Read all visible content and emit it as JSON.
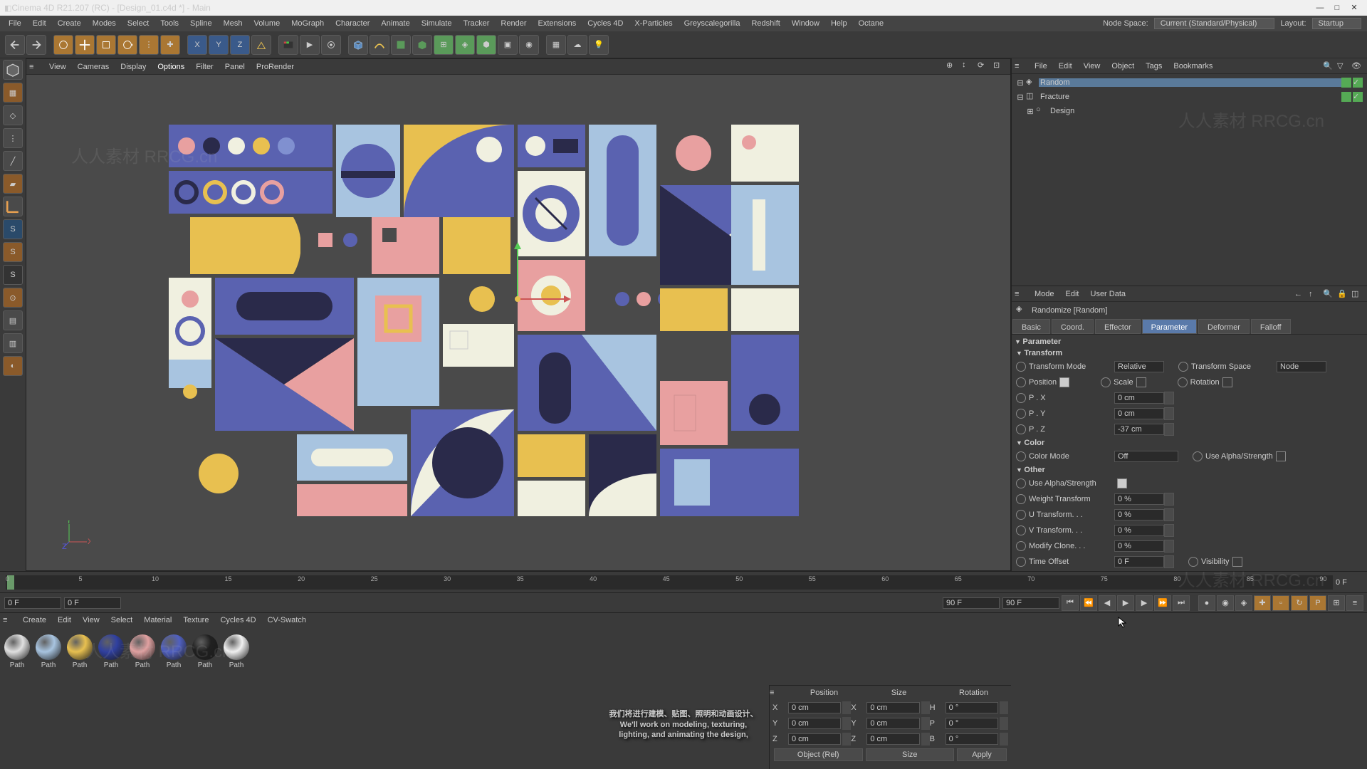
{
  "titlebar": {
    "title": "Cinema 4D R21.207 (RC) - [Design_01.c4d *] - Main"
  },
  "menubar": {
    "items": [
      "File",
      "Edit",
      "Create",
      "Modes",
      "Select",
      "Tools",
      "Spline",
      "Mesh",
      "Volume",
      "MoGraph",
      "Character",
      "Animate",
      "Simulate",
      "Tracker",
      "Render",
      "Extensions",
      "Cycles 4D",
      "X-Particles",
      "Greyscalegorilla",
      "Redshift",
      "Window",
      "Help",
      "Octane"
    ],
    "nodespace_label": "Node Space:",
    "nodespace_value": "Current (Standard/Physical)",
    "layout_label": "Layout:",
    "layout_value": "Startup"
  },
  "viewport_menu": {
    "items": [
      "View",
      "Cameras",
      "Display",
      "Options",
      "Filter",
      "Panel",
      "ProRender"
    ],
    "active": "Options"
  },
  "object_manager": {
    "menu": [
      "File",
      "Edit",
      "View",
      "Object",
      "Tags",
      "Bookmarks"
    ],
    "nodes": [
      {
        "name": "Random",
        "icon": "random",
        "selected": true,
        "indent": 1
      },
      {
        "name": "Fracture",
        "icon": "fracture",
        "selected": false,
        "indent": 1
      },
      {
        "name": "Design",
        "icon": "null",
        "selected": false,
        "indent": 2
      }
    ]
  },
  "attribute_manager": {
    "menu": [
      "Mode",
      "Edit",
      "User Data"
    ],
    "object_name": "Randomize [Random]",
    "tabs": [
      "Basic",
      "Coord.",
      "Effector",
      "Parameter",
      "Deformer",
      "Falloff"
    ],
    "active_tab": "Parameter",
    "section": "Parameter",
    "groups": {
      "transform": {
        "label": "Transform",
        "transform_mode_label": "Transform Mode",
        "transform_mode_value": "Relative",
        "transform_space_label": "Transform Space",
        "transform_space_value": "Node",
        "position_label": "Position",
        "scale_label": "Scale",
        "rotation_label": "Rotation",
        "px_label": "P . X",
        "px_value": "0 cm",
        "py_label": "P . Y",
        "py_value": "0 cm",
        "pz_label": "P . Z",
        "pz_value": "-37 cm"
      },
      "color": {
        "label": "Color",
        "color_mode_label": "Color Mode",
        "color_mode_value": "Off",
        "use_alpha_label": "Use Alpha/Strength"
      },
      "other": {
        "label": "Other",
        "use_alpha_label": "Use Alpha/Strength",
        "weight_label": "Weight Transform",
        "weight_value": "0 %",
        "u_label": "U Transform. . .",
        "u_value": "0 %",
        "v_label": "V Transform. . .",
        "v_value": "0 %",
        "modify_label": "Modify Clone. . .",
        "modify_value": "0 %",
        "time_label": "Time Offset",
        "time_value": "0 F",
        "visibility_label": "Visibility"
      }
    }
  },
  "timeline": {
    "ticks": [
      "0",
      "5",
      "10",
      "15",
      "20",
      "25",
      "30",
      "35",
      "40",
      "45",
      "50",
      "55",
      "60",
      "65",
      "70",
      "75",
      "80",
      "85",
      "90"
    ],
    "end_label": "0 F",
    "start_frame": "0 F",
    "goto_frame": "0 F",
    "end_frame": "90 F",
    "range_end": "90 F"
  },
  "material_manager": {
    "menu": [
      "Create",
      "Edit",
      "View",
      "Select",
      "Material",
      "Texture",
      "Cycles 4D",
      "CV-Swatch"
    ],
    "materials": [
      {
        "label": "Path",
        "color": "#e0e0e0"
      },
      {
        "label": "Path",
        "color": "#a8c4e0"
      },
      {
        "label": "Path",
        "color": "#e8c050"
      },
      {
        "label": "Path",
        "color": "#3040a0"
      },
      {
        "label": "Path",
        "color": "#e0a0a0"
      },
      {
        "label": "Path",
        "color": "#5060c0"
      },
      {
        "label": "Path",
        "color": "#202020"
      },
      {
        "label": "Path",
        "color": "#f0f0f0"
      }
    ]
  },
  "coord_manager": {
    "headers": [
      "Position",
      "Size",
      "Rotation"
    ],
    "rows": [
      {
        "p": "0 cm",
        "s": "0 cm",
        "r": "0 °",
        "axes": [
          "X",
          "H"
        ]
      },
      {
        "p": "0 cm",
        "s": "0 cm",
        "r": "0 °",
        "axes": [
          "Y",
          "P"
        ]
      },
      {
        "p": "0 cm",
        "s": "0 cm",
        "r": "0 °",
        "axes": [
          "Z",
          "B"
        ]
      }
    ],
    "mode": "Object (Rel)",
    "size_mode": "Size",
    "apply": "Apply"
  },
  "subtitle": {
    "line1": "我们将进行建模、贴图、照明和动画设计、",
    "line2": "We'll work on modeling, texturing,",
    "line3": "lighting, and animating the design,"
  },
  "watermark": "人人素材 RRCG.cn"
}
